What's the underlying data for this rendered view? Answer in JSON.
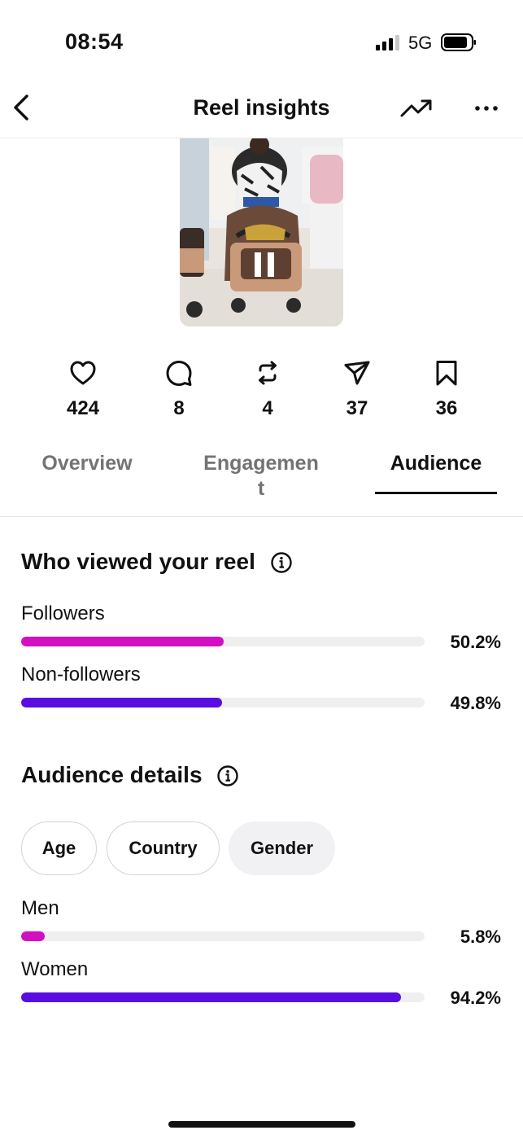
{
  "status_bar": {
    "time": "08:54",
    "network": "5G"
  },
  "header": {
    "title": "Reel insights"
  },
  "stats": [
    {
      "icon": "heart-icon",
      "value": "424"
    },
    {
      "icon": "comment-icon",
      "value": "8"
    },
    {
      "icon": "repost-icon",
      "value": "4"
    },
    {
      "icon": "share-icon",
      "value": "37"
    },
    {
      "icon": "bookmark-icon",
      "value": "36"
    }
  ],
  "tabs": {
    "overview": "Overview",
    "engagement_line1": "Engagemen",
    "engagement_line2": "t",
    "audience": "Audience",
    "active": "Audience"
  },
  "viewers": {
    "title": "Who viewed your reel",
    "rows": [
      {
        "label": "Followers",
        "value": "50.2%",
        "fraction": 0.502,
        "color": "#d30fc2"
      },
      {
        "label": "Non-followers",
        "value": "49.8%",
        "fraction": 0.498,
        "color": "#5a0de0"
      }
    ]
  },
  "audience_details": {
    "title": "Audience details",
    "chips": [
      {
        "label": "Age",
        "selected": false
      },
      {
        "label": "Country",
        "selected": false
      },
      {
        "label": "Gender",
        "selected": true
      }
    ],
    "rows": [
      {
        "label": "Men",
        "value": "5.8%",
        "fraction": 0.058,
        "color": "#d30fc2"
      },
      {
        "label": "Women",
        "value": "94.2%",
        "fraction": 0.942,
        "color": "#5a0de0"
      }
    ]
  },
  "colors": {
    "accent_pink": "#d30fc2",
    "accent_purple": "#5a0de0",
    "track": "#efefef"
  }
}
